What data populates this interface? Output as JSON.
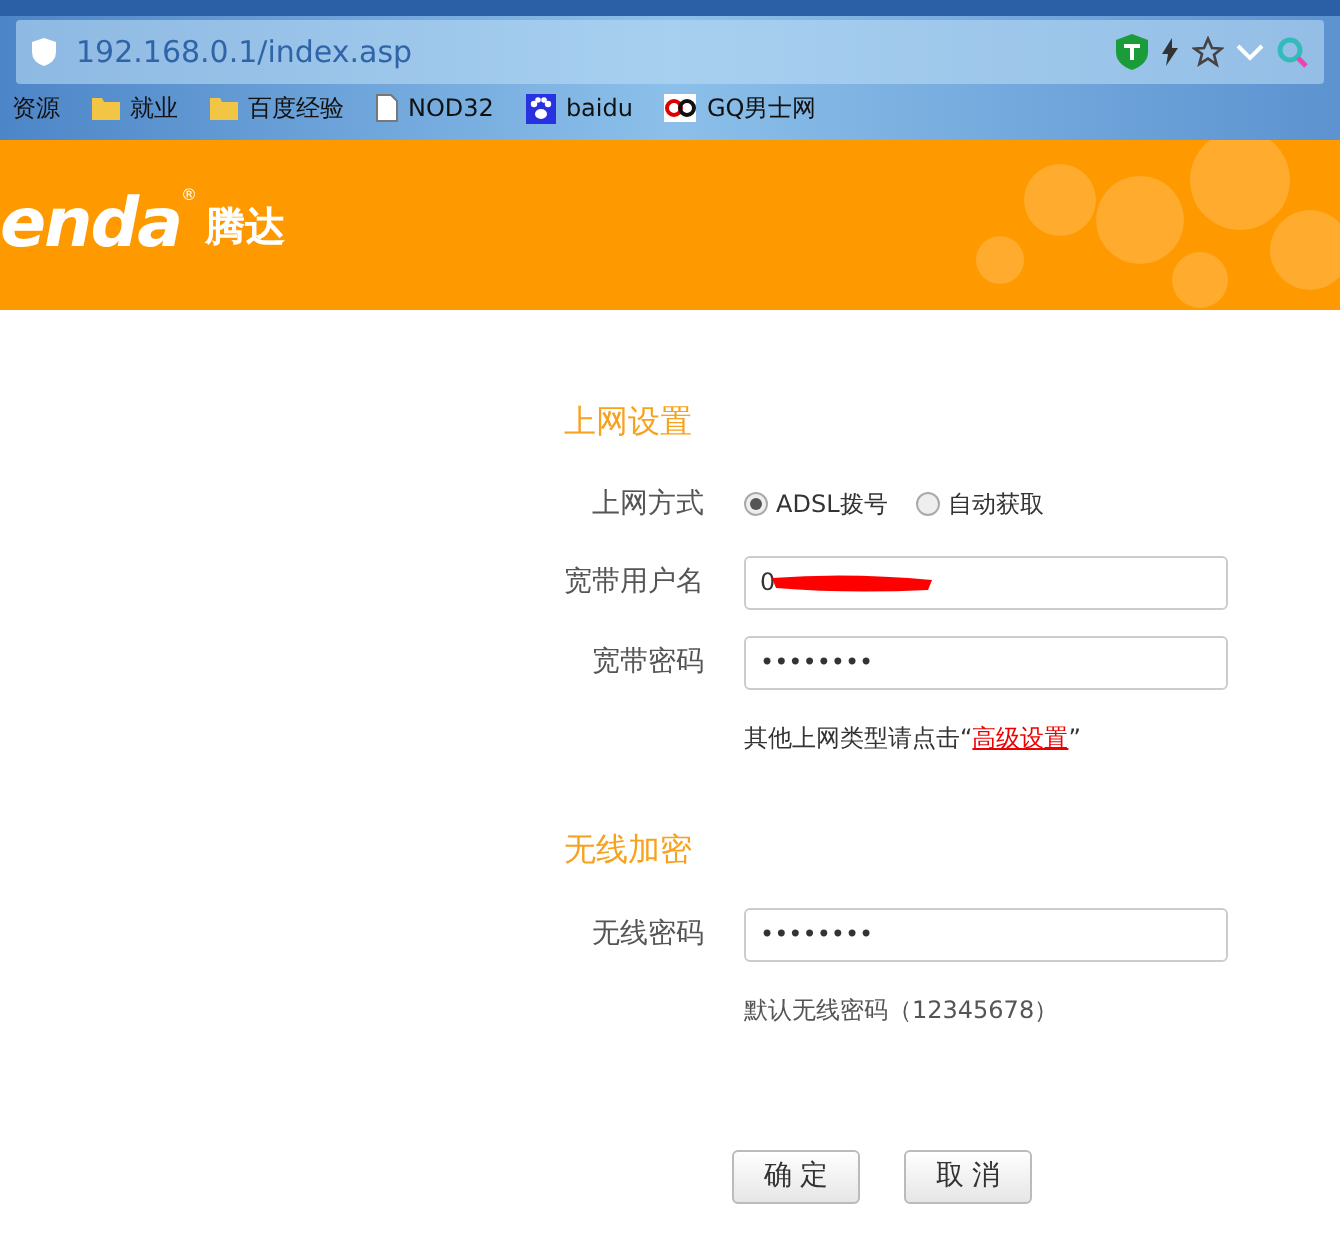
{
  "browser": {
    "url": "192.168.0.1/index.asp",
    "bookmarks": [
      {
        "kind": "text",
        "label": "资源"
      },
      {
        "kind": "folder",
        "label": "就业"
      },
      {
        "kind": "folder",
        "label": "百度经验"
      },
      {
        "kind": "page",
        "label": "NOD32"
      },
      {
        "kind": "paw",
        "label": "baidu"
      },
      {
        "kind": "gq",
        "label": "GQ男士网"
      }
    ]
  },
  "banner": {
    "logo": "enda",
    "logo_mark": "®",
    "brand": "腾达"
  },
  "sections": [
    {
      "title": "上网设置",
      "rows": [
        {
          "kind": "radio",
          "label": "上网方式",
          "options": [
            {
              "label": "ADSL拨号",
              "selected": true
            },
            {
              "label": "自动获取",
              "selected": false
            }
          ]
        },
        {
          "kind": "field",
          "label": "宽带用户名",
          "value": "0",
          "redacted": true
        },
        {
          "kind": "field",
          "label": "宽带密码",
          "value": "••••••••",
          "redacted": false
        },
        {
          "kind": "hint",
          "text": "其他上网类型请点击“",
          "link": "高级设置",
          "after": "”"
        }
      ]
    },
    {
      "title": "无线加密",
      "rows": [
        {
          "kind": "field",
          "label": "无线密码",
          "value": "••••••••",
          "redacted": false
        },
        {
          "kind": "hint",
          "text": "默认无线密码（12345678）"
        }
      ]
    }
  ],
  "buttons": [
    "确 定",
    "取 消"
  ]
}
